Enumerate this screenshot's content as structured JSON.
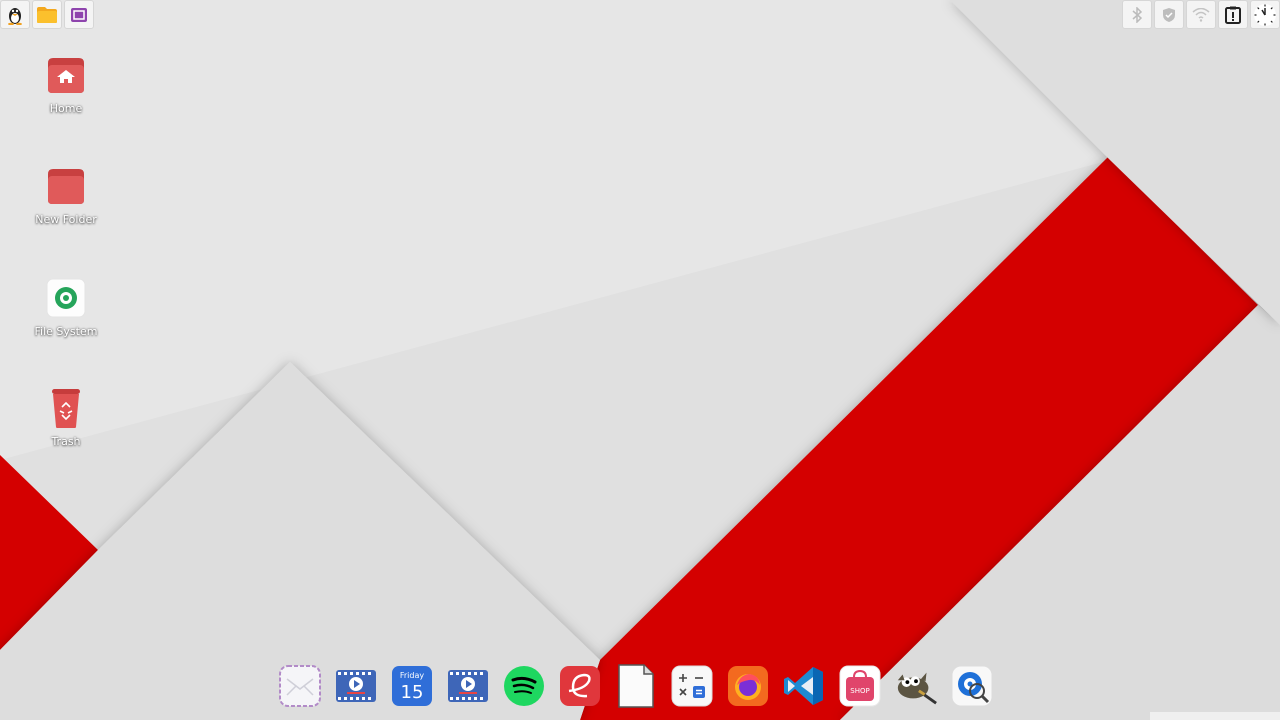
{
  "desktop": {
    "icons": [
      {
        "label": "Home",
        "icon": "home-folder-icon"
      },
      {
        "label": "New Folder",
        "icon": "folder-icon"
      },
      {
        "label": "File System",
        "icon": "drive-icon"
      },
      {
        "label": "Trash",
        "icon": "trash-icon"
      }
    ]
  },
  "top_left": [
    {
      "icon": "linux-penguin-icon"
    },
    {
      "icon": "files-icon"
    },
    {
      "icon": "screenshot-icon"
    }
  ],
  "top_right": [
    {
      "icon": "bluetooth-icon"
    },
    {
      "icon": "shield-icon"
    },
    {
      "icon": "wifi-icon"
    },
    {
      "icon": "clipboard-alert-icon"
    },
    {
      "icon": "clock-icon"
    }
  ],
  "dock": {
    "calendar_day_name": "Friday",
    "calendar_day_number": "15",
    "shop_label": "SHOP",
    "items": [
      "mail-icon",
      "video-player-icon",
      "calendar-icon",
      "video-player-icon",
      "spotify-icon",
      "elementary-icon",
      "document-icon",
      "calculator-icon",
      "firefox-icon",
      "vscode-icon",
      "shop-icon",
      "gimp-icon",
      "disk-search-icon"
    ]
  },
  "colors": {
    "wallpaper_light": "#e2e2e2",
    "wallpaper_red": "#d40000",
    "folder_red": "#e05252"
  }
}
